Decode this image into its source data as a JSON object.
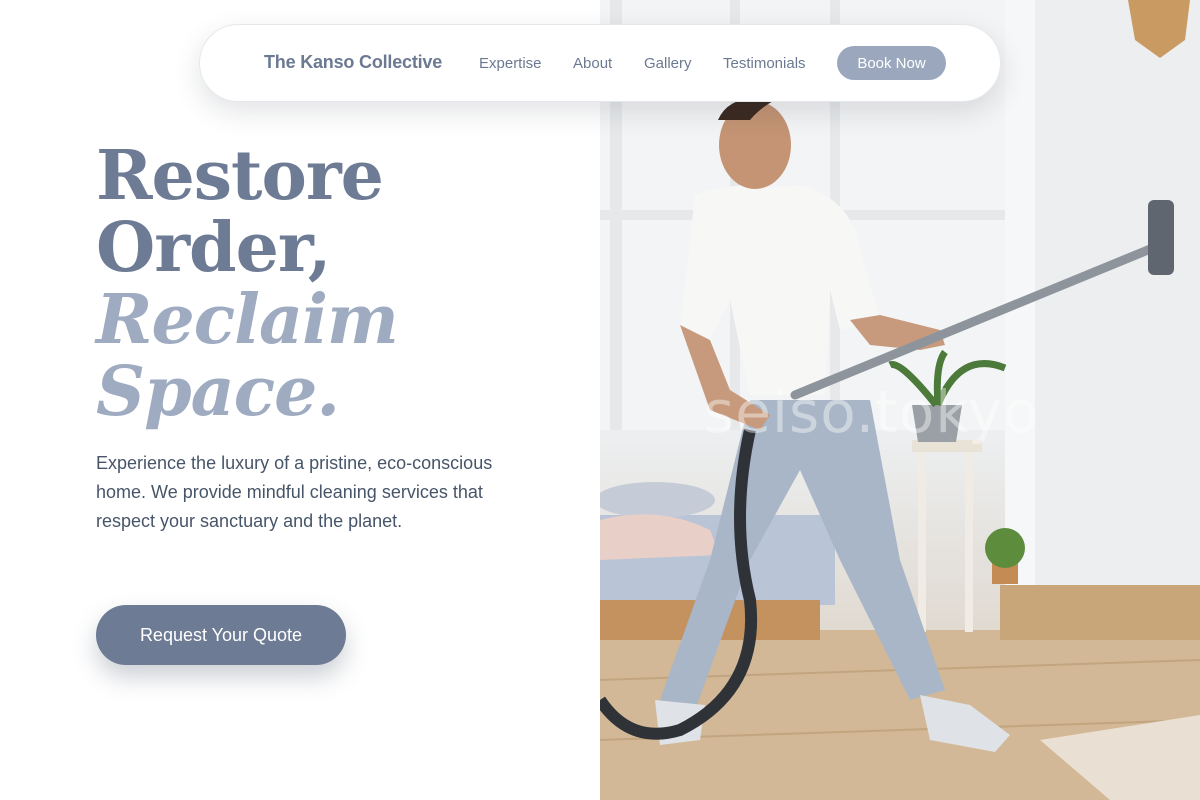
{
  "nav": {
    "brand": "The Kanso Collective",
    "links": [
      "Expertise",
      "About",
      "Gallery",
      "Testimonials"
    ],
    "book_label": "Book Now"
  },
  "hero": {
    "title_line1": "Restore",
    "title_line2": "Order,",
    "title_line3": "Reclaim",
    "title_line4": "Space.",
    "description": "Experience the luxury of a pristine, eco-conscious home. We provide mindful cleaning services that respect your sanctuary and the planet.",
    "cta_label": "Request Your Quote"
  },
  "image": {
    "watermark": "seiso.tokyo",
    "subject": "man-with-vacuum"
  },
  "colors": {
    "primary": "#6d7b94",
    "accent_light": "#9eabc0",
    "button_nav": "#9aa7bd",
    "text": "#475569"
  }
}
